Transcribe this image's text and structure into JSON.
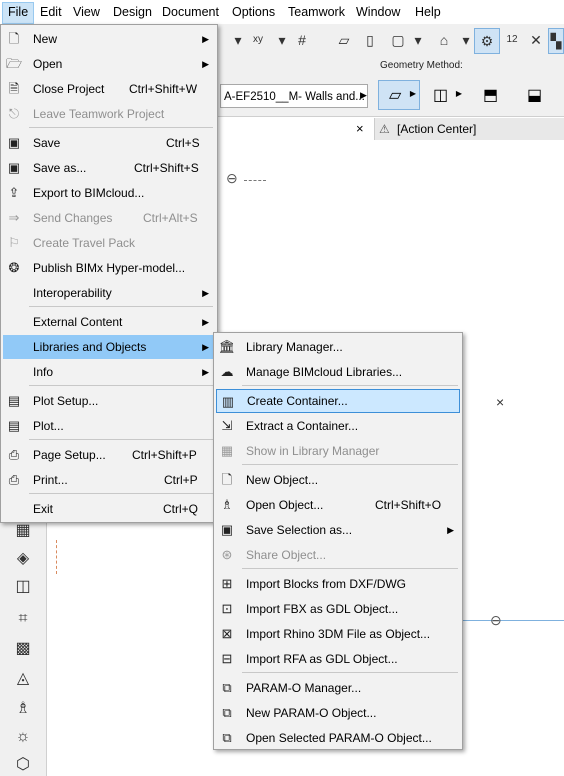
{
  "menubar": {
    "items": [
      "File",
      "Edit",
      "View",
      "Design",
      "Document",
      "Options",
      "Teamwork",
      "Window",
      "Help"
    ]
  },
  "infobox": {
    "layer_field": "A-EF2510__M- Walls and...",
    "geometry_label": "Geometry Method:"
  },
  "tabs": {
    "action_center": "[Action Center]",
    "close_glyph": "×"
  },
  "file_menu": [
    {
      "label": "New",
      "shortcut": "",
      "icon": "new-icon",
      "arrow": true,
      "disabled": false
    },
    {
      "label": "Open",
      "shortcut": "",
      "icon": "open-folder-icon",
      "arrow": true,
      "disabled": false
    },
    {
      "label": "Close Project",
      "shortcut": "Ctrl+Shift+W",
      "icon": "close-project-icon",
      "arrow": false,
      "disabled": false
    },
    {
      "label": "Leave Teamwork Project",
      "shortcut": "",
      "icon": "leave-teamwork-icon",
      "arrow": false,
      "disabled": true
    },
    {
      "label": "Save",
      "shortcut": "Ctrl+S",
      "icon": "save-icon",
      "arrow": false,
      "disabled": false
    },
    {
      "label": "Save as...",
      "shortcut": "Ctrl+Shift+S",
      "icon": "save-as-icon",
      "arrow": false,
      "disabled": false
    },
    {
      "label": "Export to BIMcloud...",
      "shortcut": "",
      "icon": "export-bimcloud-icon",
      "arrow": false,
      "disabled": false
    },
    {
      "label": "Send Changes",
      "shortcut": "Ctrl+Alt+S",
      "icon": "send-changes-icon",
      "arrow": false,
      "disabled": true
    },
    {
      "label": "Create Travel Pack",
      "shortcut": "",
      "icon": "travel-pack-icon",
      "arrow": false,
      "disabled": true
    },
    {
      "label": "Publish BIMx Hyper-model...",
      "shortcut": "",
      "icon": "bimx-icon",
      "arrow": false,
      "disabled": false
    },
    {
      "label": "Interoperability",
      "shortcut": "",
      "icon": "",
      "arrow": true,
      "disabled": false
    },
    {
      "label": "External Content",
      "shortcut": "",
      "icon": "",
      "arrow": true,
      "disabled": false
    },
    {
      "label": "Libraries and Objects",
      "shortcut": "",
      "icon": "",
      "arrow": true,
      "disabled": false
    },
    {
      "label": "Info",
      "shortcut": "",
      "icon": "",
      "arrow": true,
      "disabled": false
    },
    {
      "label": "Plot Setup...",
      "shortcut": "",
      "icon": "plot-setup-icon",
      "arrow": false,
      "disabled": false
    },
    {
      "label": "Plot...",
      "shortcut": "",
      "icon": "plot-icon",
      "arrow": false,
      "disabled": false
    },
    {
      "label": "Page Setup...",
      "shortcut": "Ctrl+Shift+P",
      "icon": "page-setup-icon",
      "arrow": false,
      "disabled": false
    },
    {
      "label": "Print...",
      "shortcut": "Ctrl+P",
      "icon": "print-icon",
      "arrow": false,
      "disabled": false
    },
    {
      "label": "Exit",
      "shortcut": "Ctrl+Q",
      "icon": "",
      "arrow": false,
      "disabled": false
    }
  ],
  "libraries_menu": [
    {
      "label": "Library Manager...",
      "shortcut": "",
      "icon": "library-manager-icon",
      "arrow": false,
      "disabled": false
    },
    {
      "label": "Manage BIMcloud Libraries...",
      "shortcut": "",
      "icon": "bimcloud-libraries-icon",
      "arrow": false,
      "disabled": false
    },
    {
      "label": "Create Container...",
      "shortcut": "",
      "icon": "create-container-icon",
      "arrow": false,
      "disabled": false
    },
    {
      "label": "Extract a Container...",
      "shortcut": "",
      "icon": "extract-container-icon",
      "arrow": false,
      "disabled": false
    },
    {
      "label": "Show in Library Manager",
      "shortcut": "",
      "icon": "show-in-library-icon",
      "arrow": false,
      "disabled": true
    },
    {
      "label": "New Object...",
      "shortcut": "",
      "icon": "new-object-icon",
      "arrow": false,
      "disabled": false
    },
    {
      "label": "Open Object...",
      "shortcut": "Ctrl+Shift+O",
      "icon": "open-object-icon",
      "arrow": false,
      "disabled": false
    },
    {
      "label": "Save Selection as...",
      "shortcut": "",
      "icon": "save-selection-icon",
      "arrow": true,
      "disabled": false
    },
    {
      "label": "Share Object...",
      "shortcut": "",
      "icon": "share-object-icon",
      "arrow": false,
      "disabled": true
    },
    {
      "label": "Import Blocks from DXF/DWG",
      "shortcut": "",
      "icon": "import-dxf-icon",
      "arrow": false,
      "disabled": false
    },
    {
      "label": "Import FBX as GDL Object...",
      "shortcut": "",
      "icon": "import-fbx-icon",
      "arrow": false,
      "disabled": false
    },
    {
      "label": "Import Rhino 3DM File as Object...",
      "shortcut": "",
      "icon": "import-rhino-icon",
      "arrow": false,
      "disabled": false
    },
    {
      "label": "Import RFA as GDL Object...",
      "shortcut": "",
      "icon": "import-rfa-icon",
      "arrow": false,
      "disabled": false
    },
    {
      "label": "PARAM-O Manager...",
      "shortcut": "",
      "icon": "param-o-manager-icon",
      "arrow": false,
      "disabled": false
    },
    {
      "label": "New PARAM-O Object...",
      "shortcut": "",
      "icon": "new-param-o-icon",
      "arrow": false,
      "disabled": false
    },
    {
      "label": "Open Selected PARAM-O Object...",
      "shortcut": "",
      "icon": "open-param-o-icon",
      "arrow": false,
      "disabled": false
    }
  ],
  "colors": {
    "menu_highlight": "#91c9f7",
    "hover_box": "#cce8ff",
    "hover_border": "#3d8fd8"
  }
}
